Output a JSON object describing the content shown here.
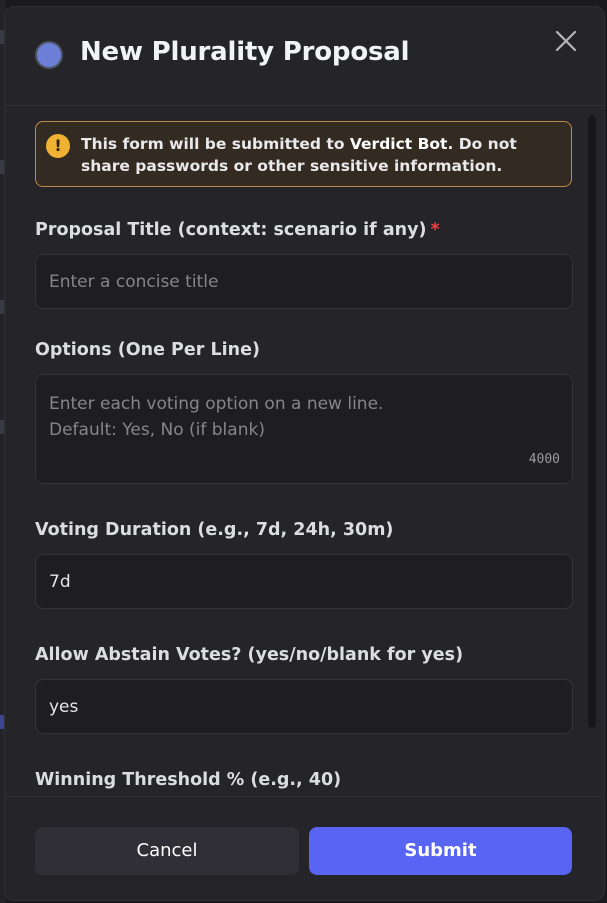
{
  "colors": {
    "brand": "#5865f2",
    "warning_border": "#c08a4a",
    "warning_icon": "#f0b232",
    "required_star": "#f23f43",
    "surface": "#242429"
  },
  "header": {
    "title": "New Plurality Proposal",
    "app_icon": "circle-avatar-icon",
    "close_icon": "close-icon"
  },
  "notice": {
    "icon": "exclamation-icon",
    "text_before": "This form will be submitted to ",
    "bot_name": "Verdict Bot",
    "text_after": ". Do not share passwords or other sensitive information."
  },
  "fields": {
    "title": {
      "label": "Proposal Title (context: scenario if any)",
      "required_mark": "*",
      "placeholder": "Enter a concise title",
      "value": ""
    },
    "options": {
      "label": "Options (One Per Line)",
      "placeholder": "Enter each voting option on a new line.\nDefault: Yes, No (if blank)",
      "value": "",
      "char_limit": "4000"
    },
    "duration": {
      "label": "Voting Duration (e.g., 7d, 24h, 30m)",
      "value": "7d"
    },
    "abstain": {
      "label": "Allow Abstain Votes? (yes/no/blank for yes)",
      "value": "yes"
    },
    "threshold": {
      "label": "Winning Threshold % (e.g., 40)"
    }
  },
  "footer": {
    "cancel_label": "Cancel",
    "submit_label": "Submit"
  }
}
